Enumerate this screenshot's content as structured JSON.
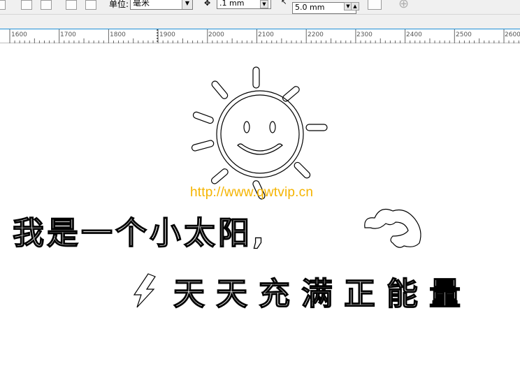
{
  "toolbar": {
    "unit_label": "单位:",
    "unit_value": "毫米",
    "nudge_value": ".1 mm",
    "duplicate_value": "5.0 mm"
  },
  "ruler": {
    "marks": [
      "1600",
      "1700",
      "1800",
      "1900",
      "2000",
      "2100",
      "2200",
      "2300",
      "2400",
      "2500",
      "2600"
    ]
  },
  "canvas": {
    "url_text": "http://www.qwtvip.cn",
    "line1": "我是一个小太阳,",
    "line2": "天天充满正能量"
  },
  "colors": {
    "accent": "#1e8fd6",
    "url": "#f5b400",
    "toolbar_bg": "#f0f0f0"
  }
}
